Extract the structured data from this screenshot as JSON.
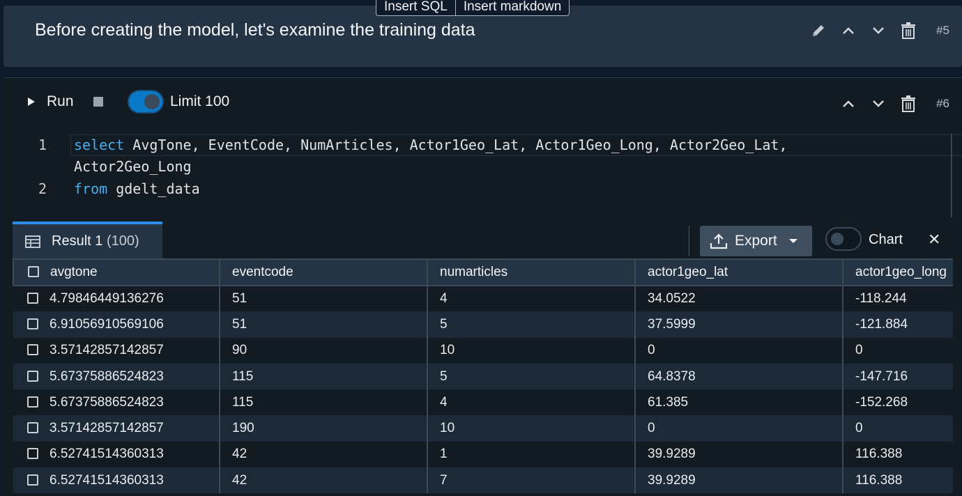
{
  "insert_bar": {
    "sql": "Insert SQL",
    "markdown": "Insert markdown"
  },
  "md_cell": {
    "text": "Before creating the model, let's examine the training data",
    "number": "#5"
  },
  "sql_cell": {
    "number": "#6",
    "run_label": "Run",
    "limit_label": "Limit 100",
    "limit_enabled": true,
    "code": {
      "line1_no": "1",
      "line1_kw": "select",
      "line1_rest": " AvgTone, EventCode, NumArticles, Actor1Geo_Lat, Actor1Geo_Long, Actor2Geo_Lat,",
      "line1_wrap": "Actor2Geo_Long",
      "line2_no": "2",
      "line2_kw": "from",
      "line2_rest": " gdelt_data"
    }
  },
  "results": {
    "tab_label": "Result 1",
    "tab_count": "(100)",
    "export_label": "Export",
    "chart_label": "Chart",
    "chart_enabled": false,
    "columns": [
      "avgtone",
      "eventcode",
      "numarticles",
      "actor1geo_lat",
      "actor1geo_long"
    ],
    "rows": [
      [
        "4.79846449136276",
        "51",
        "4",
        "34.0522",
        "-118.244"
      ],
      [
        "6.91056910569106",
        "51",
        "5",
        "37.5999",
        "-121.884"
      ],
      [
        "3.57142857142857",
        "90",
        "10",
        "0",
        "0"
      ],
      [
        "5.67375886524823",
        "115",
        "5",
        "64.8378",
        "-147.716"
      ],
      [
        "5.67375886524823",
        "115",
        "4",
        "61.385",
        "-152.268"
      ],
      [
        "3.57142857142857",
        "190",
        "10",
        "0",
        "0"
      ],
      [
        "6.52741514360313",
        "42",
        "1",
        "39.9289",
        "116.388"
      ],
      [
        "6.52741514360313",
        "42",
        "7",
        "39.9289",
        "116.388"
      ]
    ]
  },
  "colors": {
    "accent": "#0a79c8",
    "keyword": "#4aaef0",
    "tab_border": "#2c8ce6"
  }
}
